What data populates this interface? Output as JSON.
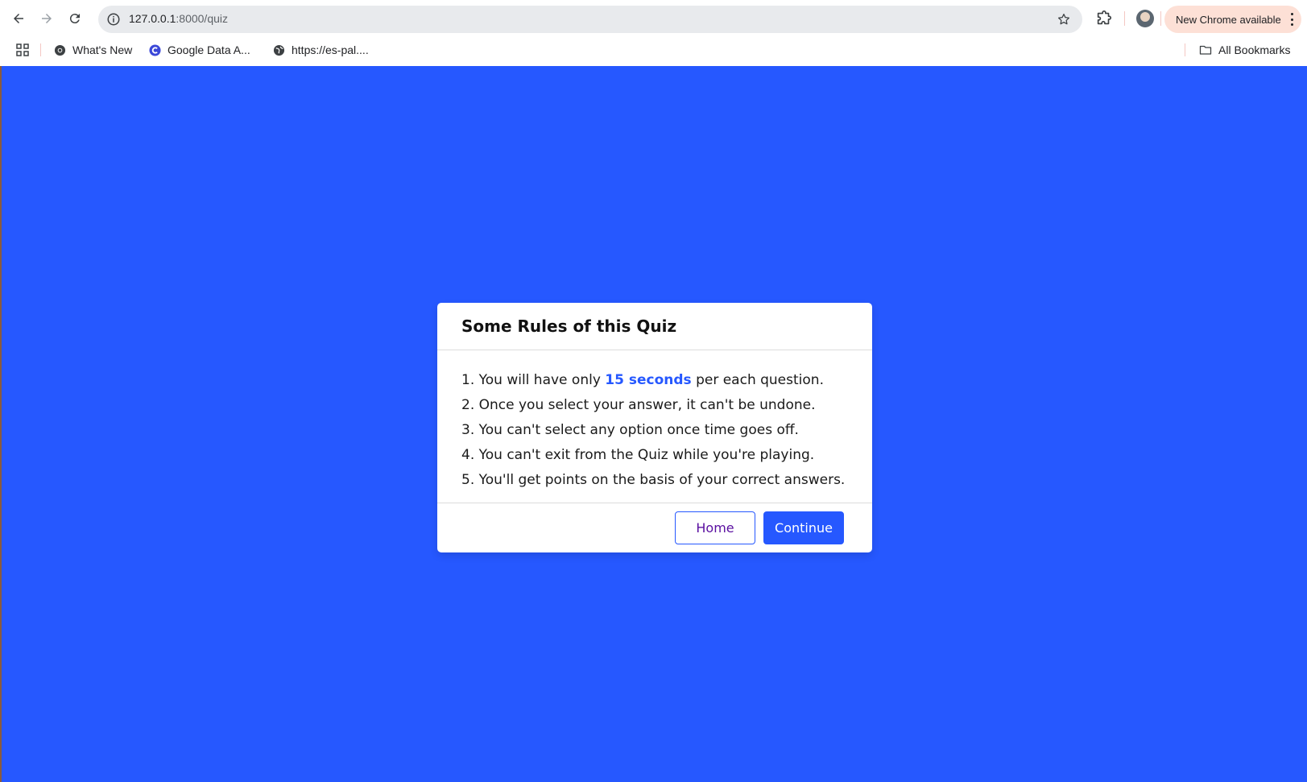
{
  "browser": {
    "url_host": "127.0.0.1",
    "url_path": ":8000/quiz",
    "update_chip_label": "New Chrome available",
    "bookmarks": [
      {
        "label": "What's New",
        "icon": "chrome-icon"
      },
      {
        "label": "Google Data A...",
        "icon": "google-c-icon"
      },
      {
        "label": "https://es-pal....",
        "icon": "globe-icon"
      }
    ],
    "all_bookmarks_label": "All Bookmarks"
  },
  "page": {
    "background_color": "#2658ff"
  },
  "modal": {
    "title": "Some Rules of this Quiz",
    "rules": [
      {
        "prefix": "1. You will have only ",
        "highlight": "15 seconds",
        "suffix": " per each question."
      },
      {
        "text": "2. Once you select your answer, it can't be undone."
      },
      {
        "text": "3. You can't select any option once time goes off."
      },
      {
        "text": "4. You can't exit from the Quiz while you're playing."
      },
      {
        "text": "5. You'll get points on the basis of your correct answers."
      }
    ],
    "home_label": "Home",
    "continue_label": "Continue",
    "accent_color": "#2658ff"
  }
}
